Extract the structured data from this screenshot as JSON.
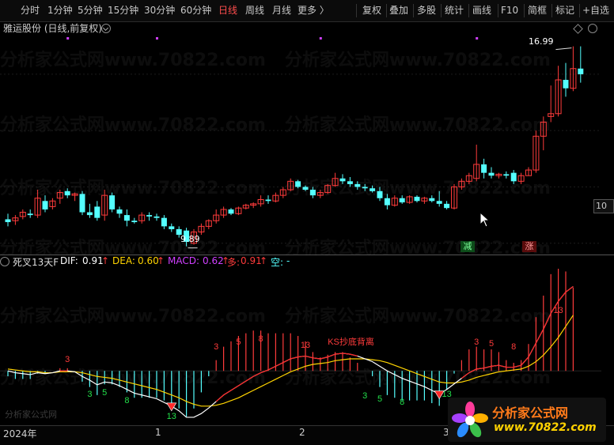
{
  "toolbar": {
    "periods": [
      "分时",
      "1分钟",
      "5分钟",
      "15分钟",
      "30分钟",
      "60分钟",
      "日线",
      "周线",
      "月线",
      "更多 〉"
    ],
    "active_period": "日线",
    "tools": [
      "复权",
      "叠加",
      "多股",
      "统计",
      "画线",
      "F10",
      "简框",
      "标记",
      "+自选"
    ]
  },
  "header": {
    "title": "雅运股份 (日线,前复权)"
  },
  "main_chart": {
    "high_label": "16.99",
    "low_label": "9.89",
    "price_box": "10",
    "signal_reduce": "减",
    "signal_increase": "涨",
    "colors": {
      "up": "#ff3b3b",
      "down": "#54ffff",
      "dot": "#d040ff"
    }
  },
  "indicator": {
    "name": "死叉13天F",
    "dif_label": "DIF:",
    "dif_value": "0.91",
    "dea_label": "DEA:",
    "dea_value": "0.60",
    "macd_label": "MACD:",
    "macd_value": "0.62",
    "duo_label": "多:",
    "duo_value": "0.91",
    "kong_label": "空:",
    "kong_value": "-",
    "colors": {
      "dif": "#ffffff",
      "dea": "#ffd400",
      "macd": "#d040ff",
      "duo": "#ff3b3b",
      "kong": "#54ffff"
    },
    "annotation": "KS抄底背离",
    "count_labels_red": [
      "3",
      "3",
      "5",
      "8",
      "13",
      "3",
      "5",
      "8",
      "13"
    ],
    "count_labels_green": [
      "3",
      "5",
      "8",
      "13",
      "3",
      "5",
      "8",
      "13"
    ]
  },
  "x_axis": {
    "labels": [
      "2024年",
      "1",
      "2",
      "3"
    ]
  },
  "watermark": {
    "text": "分析家公式网www.70822.com",
    "small": "分析家公式网"
  },
  "logo": {
    "line1": "分析家公式网",
    "line2": "www.70822.com"
  },
  "chart_data": [
    {
      "type": "candlestick",
      "title": "雅运股份 (日线,前复权)",
      "annotations": [
        {
          "label": "16.99",
          "kind": "high"
        },
        {
          "label": "9.89",
          "kind": "low"
        }
      ],
      "candles": [
        {
          "o": 10.85,
          "h": 11.05,
          "l": 10.6,
          "c": 10.75
        },
        {
          "o": 10.8,
          "h": 11.0,
          "l": 10.65,
          "c": 10.9
        },
        {
          "o": 10.95,
          "h": 11.2,
          "l": 10.85,
          "c": 11.1
        },
        {
          "o": 11.05,
          "h": 11.2,
          "l": 10.9,
          "c": 11.0
        },
        {
          "o": 11.0,
          "h": 11.9,
          "l": 10.9,
          "c": 11.6
        },
        {
          "o": 11.5,
          "h": 11.7,
          "l": 11.1,
          "c": 11.2
        },
        {
          "o": 11.3,
          "h": 11.6,
          "l": 11.2,
          "c": 11.5
        },
        {
          "o": 11.6,
          "h": 11.9,
          "l": 11.4,
          "c": 11.8
        },
        {
          "o": 11.85,
          "h": 11.95,
          "l": 11.6,
          "c": 11.7
        },
        {
          "o": 11.7,
          "h": 11.8,
          "l": 11.5,
          "c": 11.75
        },
        {
          "o": 11.75,
          "h": 11.85,
          "l": 11.0,
          "c": 11.1
        },
        {
          "o": 11.1,
          "h": 11.4,
          "l": 10.9,
          "c": 11.0
        },
        {
          "o": 11.3,
          "h": 11.5,
          "l": 10.8,
          "c": 10.9
        },
        {
          "o": 11.0,
          "h": 11.9,
          "l": 10.8,
          "c": 11.7
        },
        {
          "o": 11.7,
          "h": 11.8,
          "l": 11.1,
          "c": 11.2
        },
        {
          "o": 11.2,
          "h": 11.3,
          "l": 10.9,
          "c": 11.05
        },
        {
          "o": 11.0,
          "h": 11.2,
          "l": 10.6,
          "c": 10.8
        },
        {
          "o": 10.8,
          "h": 10.9,
          "l": 10.7,
          "c": 10.75
        },
        {
          "o": 10.8,
          "h": 11.1,
          "l": 10.7,
          "c": 11.0
        },
        {
          "o": 11.0,
          "h": 11.1,
          "l": 10.8,
          "c": 10.95
        },
        {
          "o": 10.95,
          "h": 11.05,
          "l": 10.8,
          "c": 10.9
        },
        {
          "o": 10.9,
          "h": 11.0,
          "l": 10.5,
          "c": 10.6
        },
        {
          "o": 10.6,
          "h": 10.7,
          "l": 10.4,
          "c": 10.5
        },
        {
          "o": 10.5,
          "h": 10.6,
          "l": 10.2,
          "c": 10.3
        },
        {
          "o": 10.45,
          "h": 10.55,
          "l": 9.89,
          "c": 10.05
        },
        {
          "o": 10.0,
          "h": 10.5,
          "l": 9.95,
          "c": 10.4
        },
        {
          "o": 10.4,
          "h": 10.7,
          "l": 10.3,
          "c": 10.6
        },
        {
          "o": 10.6,
          "h": 10.85,
          "l": 10.5,
          "c": 10.8
        },
        {
          "o": 10.8,
          "h": 11.2,
          "l": 10.7,
          "c": 11.0
        },
        {
          "o": 11.0,
          "h": 11.3,
          "l": 10.9,
          "c": 11.2
        },
        {
          "o": 11.2,
          "h": 11.25,
          "l": 11.0,
          "c": 11.05
        },
        {
          "o": 11.05,
          "h": 11.3,
          "l": 11.0,
          "c": 11.25
        },
        {
          "o": 11.25,
          "h": 11.4,
          "l": 11.2,
          "c": 11.35
        },
        {
          "o": 11.35,
          "h": 11.45,
          "l": 11.25,
          "c": 11.4
        },
        {
          "o": 11.4,
          "h": 11.7,
          "l": 11.3,
          "c": 11.55
        },
        {
          "o": 11.55,
          "h": 11.7,
          "l": 11.4,
          "c": 11.5
        },
        {
          "o": 11.5,
          "h": 11.8,
          "l": 11.45,
          "c": 11.7
        },
        {
          "o": 11.7,
          "h": 12.0,
          "l": 11.6,
          "c": 11.9
        },
        {
          "o": 11.9,
          "h": 12.3,
          "l": 11.85,
          "c": 12.2
        },
        {
          "o": 12.2,
          "h": 12.25,
          "l": 11.95,
          "c": 12.0
        },
        {
          "o": 12.0,
          "h": 12.05,
          "l": 11.85,
          "c": 11.9
        },
        {
          "o": 11.9,
          "h": 12.0,
          "l": 11.6,
          "c": 11.7
        },
        {
          "o": 11.7,
          "h": 11.9,
          "l": 11.6,
          "c": 11.8
        },
        {
          "o": 11.8,
          "h": 12.1,
          "l": 11.75,
          "c": 12.05
        },
        {
          "o": 12.05,
          "h": 12.5,
          "l": 12.0,
          "c": 12.3
        },
        {
          "o": 12.3,
          "h": 12.45,
          "l": 12.1,
          "c": 12.2
        },
        {
          "o": 12.2,
          "h": 12.35,
          "l": 12.0,
          "c": 12.1
        },
        {
          "o": 12.1,
          "h": 12.2,
          "l": 11.9,
          "c": 12.0
        },
        {
          "o": 12.0,
          "h": 12.1,
          "l": 11.85,
          "c": 11.95
        },
        {
          "o": 11.95,
          "h": 12.05,
          "l": 11.8,
          "c": 11.85
        },
        {
          "o": 11.85,
          "h": 12.0,
          "l": 11.5,
          "c": 11.6
        },
        {
          "o": 11.6,
          "h": 11.75,
          "l": 11.2,
          "c": 11.35
        },
        {
          "o": 11.35,
          "h": 11.7,
          "l": 11.3,
          "c": 11.6
        },
        {
          "o": 11.6,
          "h": 11.7,
          "l": 11.4,
          "c": 11.45
        },
        {
          "o": 11.45,
          "h": 11.7,
          "l": 11.4,
          "c": 11.65
        },
        {
          "o": 11.65,
          "h": 11.7,
          "l": 11.45,
          "c": 11.5
        },
        {
          "o": 11.5,
          "h": 11.65,
          "l": 11.4,
          "c": 11.6
        },
        {
          "o": 11.6,
          "h": 11.7,
          "l": 11.45,
          "c": 11.5
        },
        {
          "o": 11.5,
          "h": 11.85,
          "l": 11.3,
          "c": 11.4
        },
        {
          "o": 11.4,
          "h": 11.5,
          "l": 11.2,
          "c": 11.25
        },
        {
          "o": 11.25,
          "h": 12.1,
          "l": 11.2,
          "c": 12.0
        },
        {
          "o": 12.0,
          "h": 12.3,
          "l": 11.9,
          "c": 12.2
        },
        {
          "o": 12.2,
          "h": 12.5,
          "l": 12.1,
          "c": 12.4
        },
        {
          "o": 12.3,
          "h": 13.5,
          "l": 12.2,
          "c": 12.8
        },
        {
          "o": 12.8,
          "h": 13.0,
          "l": 12.3,
          "c": 12.5
        },
        {
          "o": 12.5,
          "h": 12.7,
          "l": 12.3,
          "c": 12.4
        },
        {
          "o": 12.4,
          "h": 12.5,
          "l": 12.3,
          "c": 12.45
        },
        {
          "o": 12.45,
          "h": 12.55,
          "l": 12.3,
          "c": 12.4
        },
        {
          "o": 12.5,
          "h": 12.6,
          "l": 12.1,
          "c": 12.2
        },
        {
          "o": 12.2,
          "h": 12.5,
          "l": 12.1,
          "c": 12.4
        },
        {
          "o": 12.4,
          "h": 12.7,
          "l": 12.4,
          "c": 12.6
        },
        {
          "o": 12.6,
          "h": 14.0,
          "l": 12.5,
          "c": 13.8
        },
        {
          "o": 13.8,
          "h": 14.5,
          "l": 13.3,
          "c": 14.3
        },
        {
          "o": 14.5,
          "h": 15.6,
          "l": 14.3,
          "c": 14.6
        },
        {
          "o": 14.6,
          "h": 16.3,
          "l": 14.5,
          "c": 15.8
        },
        {
          "o": 15.8,
          "h": 16.4,
          "l": 15.2,
          "c": 15.5
        },
        {
          "o": 15.5,
          "h": 16.99,
          "l": 15.4,
          "c": 16.2
        },
        {
          "o": 16.2,
          "h": 16.99,
          "l": 15.7,
          "c": 16.0
        }
      ]
    },
    {
      "type": "line",
      "title": "死叉13天F",
      "series": [
        {
          "name": "DIF",
          "values": [
            0.0,
            -0.02,
            -0.03,
            -0.04,
            -0.02,
            -0.03,
            -0.02,
            0.0,
            0.0,
            -0.01,
            -0.06,
            -0.1,
            -0.15,
            -0.12,
            -0.13,
            -0.16,
            -0.2,
            -0.24,
            -0.26,
            -0.28,
            -0.3,
            -0.34,
            -0.38,
            -0.43,
            -0.5,
            -0.5,
            -0.46,
            -0.4,
            -0.33,
            -0.26,
            -0.21,
            -0.16,
            -0.11,
            -0.06,
            -0.02,
            0.01,
            0.05,
            0.09,
            0.13,
            0.15,
            0.16,
            0.14,
            0.13,
            0.15,
            0.18,
            0.19,
            0.18,
            0.16,
            0.13,
            0.1,
            0.05,
            0.0,
            -0.04,
            -0.08,
            -0.11,
            -0.14,
            -0.17,
            -0.21,
            -0.25,
            -0.2,
            -0.14,
            -0.08,
            -0.02,
            0.02,
            0.03,
            0.05,
            0.06,
            0.04,
            0.04,
            0.06,
            0.15,
            0.3,
            0.45,
            0.62,
            0.75,
            0.85,
            0.91
          ]
        },
        {
          "name": "DEA",
          "values": [
            0.02,
            0.01,
            0.0,
            -0.01,
            -0.01,
            -0.02,
            -0.02,
            -0.01,
            -0.01,
            -0.01,
            -0.02,
            -0.04,
            -0.06,
            -0.07,
            -0.08,
            -0.1,
            -0.12,
            -0.14,
            -0.16,
            -0.18,
            -0.2,
            -0.23,
            -0.26,
            -0.29,
            -0.33,
            -0.36,
            -0.38,
            -0.38,
            -0.37,
            -0.35,
            -0.32,
            -0.29,
            -0.25,
            -0.21,
            -0.17,
            -0.13,
            -0.09,
            -0.05,
            -0.01,
            0.02,
            0.05,
            0.07,
            0.08,
            0.09,
            0.11,
            0.12,
            0.13,
            0.13,
            0.13,
            0.12,
            0.11,
            0.09,
            0.06,
            0.03,
            0.0,
            -0.03,
            -0.06,
            -0.09,
            -0.12,
            -0.13,
            -0.13,
            -0.12,
            -0.1,
            -0.07,
            -0.05,
            -0.03,
            -0.01,
            0.0,
            0.01,
            0.02,
            0.05,
            0.1,
            0.17,
            0.26,
            0.36,
            0.48,
            0.6
          ]
        }
      ]
    }
  ]
}
